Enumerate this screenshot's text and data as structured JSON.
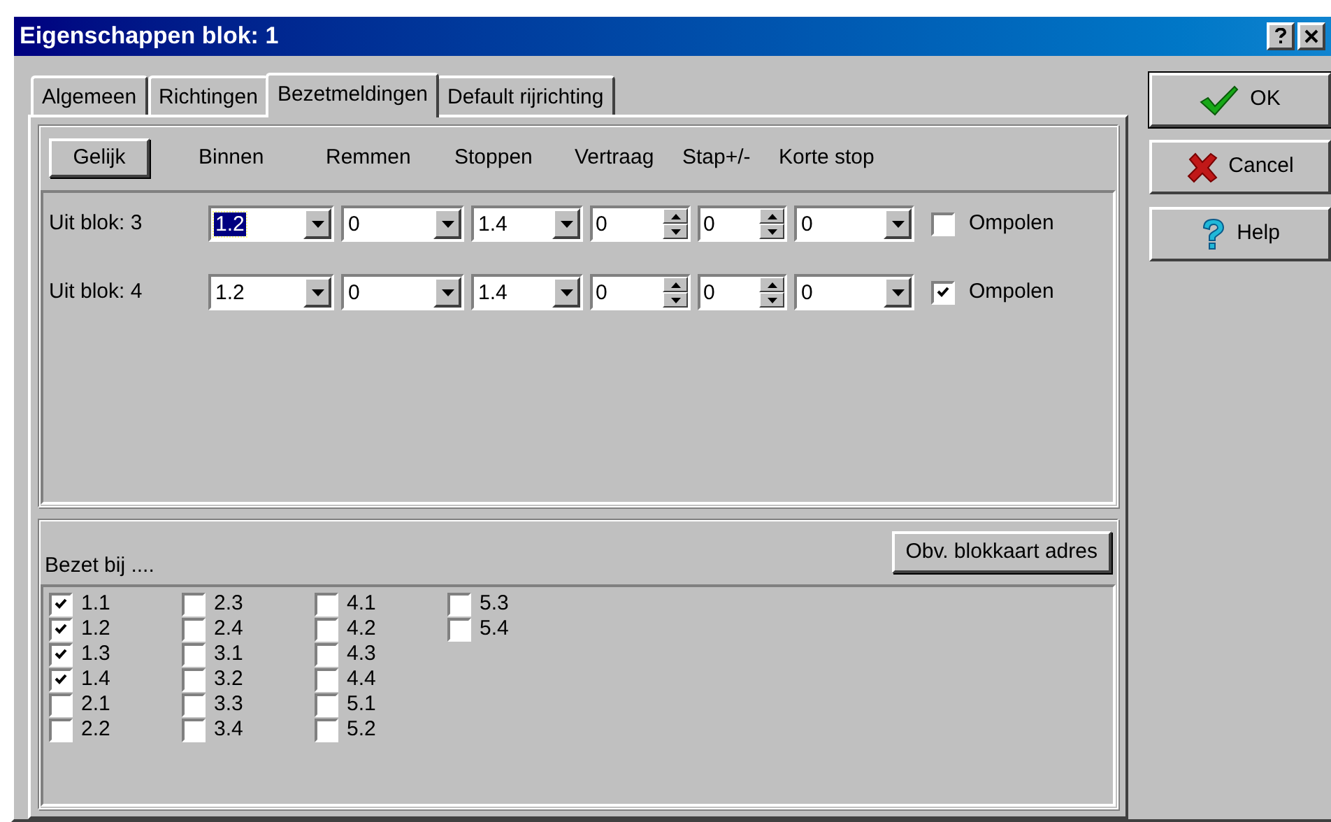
{
  "window": {
    "title": "Eigenschappen blok: 1"
  },
  "tabs": [
    {
      "label": "Algemeen",
      "selected": false
    },
    {
      "label": "Richtingen",
      "selected": false
    },
    {
      "label": "Bezetmeldingen",
      "selected": true
    },
    {
      "label": "Default rijrichting",
      "selected": false
    }
  ],
  "equal_button": "Gelijk",
  "columns": [
    "Binnen",
    "Remmen",
    "Stoppen",
    "Vertraag",
    "Stap+/-",
    "Korte stop"
  ],
  "rows": [
    {
      "label": "Uit blok: 3",
      "fields": [
        {
          "kind": "combo",
          "value": "1.2",
          "focused": true
        },
        {
          "kind": "combo",
          "value": "0",
          "focused": false
        },
        {
          "kind": "combo",
          "value": "1.4",
          "focused": false
        },
        {
          "kind": "spin",
          "value": "0",
          "focused": false
        },
        {
          "kind": "spin",
          "value": "0",
          "focused": false
        },
        {
          "kind": "combo",
          "value": "0",
          "focused": false
        }
      ],
      "option": {
        "label": "Ompolen",
        "checked": false
      }
    },
    {
      "label": "Uit blok: 4",
      "fields": [
        {
          "kind": "combo",
          "value": "1.2",
          "focused": false
        },
        {
          "kind": "combo",
          "value": "0",
          "focused": false
        },
        {
          "kind": "combo",
          "value": "1.4",
          "focused": false
        },
        {
          "kind": "spin",
          "value": "0",
          "focused": false
        },
        {
          "kind": "spin",
          "value": "0",
          "focused": false
        },
        {
          "kind": "combo",
          "value": "0",
          "focused": false
        }
      ],
      "option": {
        "label": "Ompolen",
        "checked": true
      }
    }
  ],
  "occupied": {
    "label": "Bezet bij ....",
    "button": "Obv. blokkaart adres",
    "items": [
      {
        "label": "1.1",
        "checked": true
      },
      {
        "label": "1.2",
        "checked": true
      },
      {
        "label": "1.3",
        "checked": true
      },
      {
        "label": "1.4",
        "checked": true
      },
      {
        "label": "2.1",
        "checked": false
      },
      {
        "label": "2.2",
        "checked": false
      },
      {
        "label": "2.3",
        "checked": false
      },
      {
        "label": "2.4",
        "checked": false
      },
      {
        "label": "3.1",
        "checked": false
      },
      {
        "label": "3.2",
        "checked": false
      },
      {
        "label": "3.3",
        "checked": false
      },
      {
        "label": "3.4",
        "checked": false
      },
      {
        "label": "4.1",
        "checked": false
      },
      {
        "label": "4.2",
        "checked": false
      },
      {
        "label": "4.3",
        "checked": false
      },
      {
        "label": "4.4",
        "checked": false
      },
      {
        "label": "5.1",
        "checked": false
      },
      {
        "label": "5.2",
        "checked": false
      },
      {
        "label": "5.3",
        "checked": false
      },
      {
        "label": "5.4",
        "checked": false
      }
    ]
  },
  "buttons": [
    {
      "kind": "ok",
      "label": "OK",
      "default": true
    },
    {
      "kind": "cancel",
      "label": "Cancel",
      "default": false
    },
    {
      "kind": "help",
      "label": "Help",
      "default": false
    }
  ]
}
